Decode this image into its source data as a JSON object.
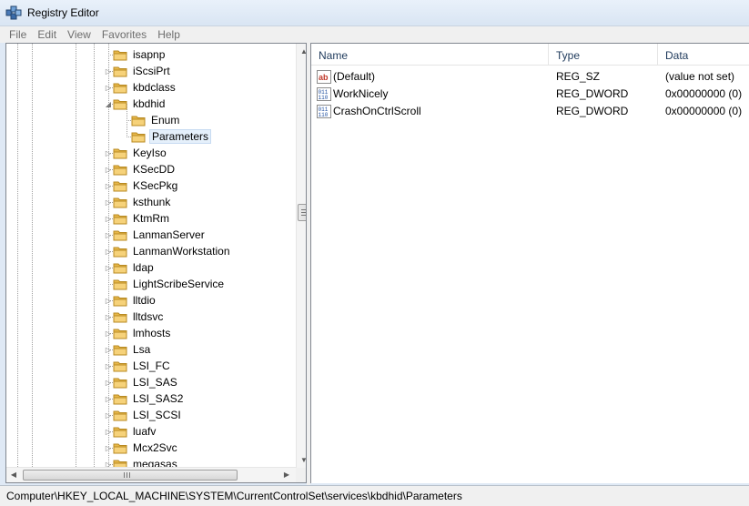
{
  "window": {
    "title": "Registry Editor",
    "app_icon": "registry-editor-icon"
  },
  "menu": [
    "File",
    "Edit",
    "View",
    "Favorites",
    "Help"
  ],
  "tree": {
    "items": [
      {
        "label": "isapnp",
        "level": 0,
        "expander": "none"
      },
      {
        "label": "iScsiPrt",
        "level": 0,
        "expander": "collapsed"
      },
      {
        "label": "kbdclass",
        "level": 0,
        "expander": "collapsed"
      },
      {
        "label": "kbdhid",
        "level": 0,
        "expander": "expanded"
      },
      {
        "label": "Enum",
        "level": 1,
        "expander": "none"
      },
      {
        "label": "Parameters",
        "level": 1,
        "expander": "none",
        "selected": true
      },
      {
        "label": "KeyIso",
        "level": 0,
        "expander": "collapsed"
      },
      {
        "label": "KSecDD",
        "level": 0,
        "expander": "collapsed"
      },
      {
        "label": "KSecPkg",
        "level": 0,
        "expander": "collapsed"
      },
      {
        "label": "ksthunk",
        "level": 0,
        "expander": "collapsed"
      },
      {
        "label": "KtmRm",
        "level": 0,
        "expander": "collapsed"
      },
      {
        "label": "LanmanServer",
        "level": 0,
        "expander": "collapsed"
      },
      {
        "label": "LanmanWorkstation",
        "level": 0,
        "expander": "collapsed"
      },
      {
        "label": "ldap",
        "level": 0,
        "expander": "collapsed"
      },
      {
        "label": "LightScribeService",
        "level": 0,
        "expander": "none"
      },
      {
        "label": "lltdio",
        "level": 0,
        "expander": "collapsed"
      },
      {
        "label": "lltdsvc",
        "level": 0,
        "expander": "collapsed"
      },
      {
        "label": "lmhosts",
        "level": 0,
        "expander": "collapsed"
      },
      {
        "label": "Lsa",
        "level": 0,
        "expander": "collapsed"
      },
      {
        "label": "LSI_FC",
        "level": 0,
        "expander": "collapsed"
      },
      {
        "label": "LSI_SAS",
        "level": 0,
        "expander": "collapsed"
      },
      {
        "label": "LSI_SAS2",
        "level": 0,
        "expander": "collapsed"
      },
      {
        "label": "LSI_SCSI",
        "level": 0,
        "expander": "collapsed"
      },
      {
        "label": "luafv",
        "level": 0,
        "expander": "collapsed"
      },
      {
        "label": "Mcx2Svc",
        "level": 0,
        "expander": "collapsed"
      },
      {
        "label": "megasas",
        "level": 0,
        "expander": "collapsed"
      }
    ],
    "scrollbar_grip": "III"
  },
  "list": {
    "columns": {
      "name": "Name",
      "type": "Type",
      "data": "Data"
    },
    "rows": [
      {
        "icon": "string-value-icon",
        "name": "(Default)",
        "type": "REG_SZ",
        "data": "(value not set)"
      },
      {
        "icon": "binary-value-icon",
        "name": "WorkNicely",
        "type": "REG_DWORD",
        "data": "0x00000000 (0)"
      },
      {
        "icon": "binary-value-icon",
        "name": "CrashOnCtrlScroll",
        "type": "REG_DWORD",
        "data": "0x00000000 (0)"
      }
    ]
  },
  "status": {
    "path": "Computer\\HKEY_LOCAL_MACHINE\\SYSTEM\\CurrentControlSet\\services\\kbdhid\\Parameters"
  },
  "colors": {
    "folder": "#e8b84a",
    "selection": "#e5f0fb",
    "header_text": "#1e395b"
  }
}
